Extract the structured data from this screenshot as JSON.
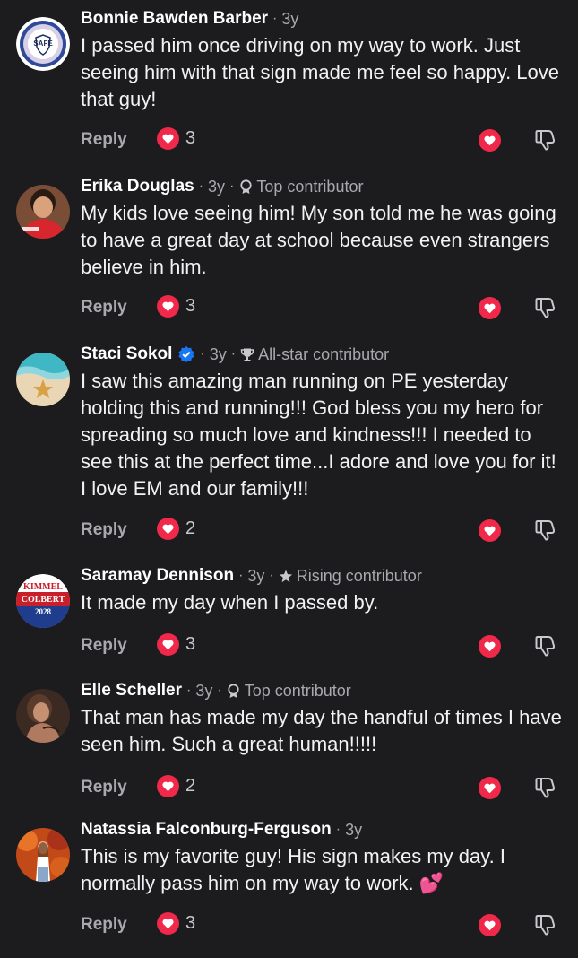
{
  "colors": {
    "background": "#1c1c1e",
    "love": "#f0284a",
    "meta": "#a8a8ad",
    "verified": "#1877f2"
  },
  "labels": {
    "reply": "Reply",
    "dot": "·"
  },
  "comments": [
    {
      "author": "Bonnie Bawden Barber",
      "time": "3y",
      "badge": "",
      "badge_icon": "",
      "verified": false,
      "text": "I passed him once driving on my way to work. Just seeing him with that sign made me feel so happy. Love that guy!",
      "reactions": "3",
      "avatar_text": "SAFE"
    },
    {
      "author": "Erika Douglas",
      "time": "3y",
      "badge": "Top contributor",
      "badge_icon": "medal-icon",
      "verified": false,
      "text": "My kids love seeing him! My son told me he was going to have a great day at school because even strangers believe in him.",
      "reactions": "3",
      "avatar_text": ""
    },
    {
      "author": "Staci Sokol",
      "time": "3y",
      "badge": "All-star contributor",
      "badge_icon": "trophy-icon",
      "verified": true,
      "text": "I saw this amazing man running on PE yesterday holding this and running!!! God bless you my hero for spreading so much love and kindness!!! I needed to see this at the perfect time...I adore and love you for it! I love EM and our family!!!",
      "reactions": "2",
      "avatar_text": ""
    },
    {
      "author": "Saramay Dennison",
      "time": "3y",
      "badge": "Rising contributor",
      "badge_icon": "star-icon",
      "verified": false,
      "text": "It made my day when I passed by.",
      "reactions": "3",
      "avatar_text": "KIMMEL COLBERT 2028"
    },
    {
      "author": "Elle Scheller",
      "time": "3y",
      "badge": "Top contributor",
      "badge_icon": "medal-icon",
      "verified": false,
      "text": "That man has made my day the handful of times I have seen him. Such a great human!!!!!",
      "reactions": "2",
      "avatar_text": ""
    },
    {
      "author": "Natassia Falconburg-Ferguson",
      "time": "3y",
      "badge": "",
      "badge_icon": "",
      "verified": false,
      "text": "This is my favorite guy! His sign makes my day. I normally pass him on my way to work. 💕",
      "reactions": "3",
      "avatar_text": ""
    }
  ]
}
